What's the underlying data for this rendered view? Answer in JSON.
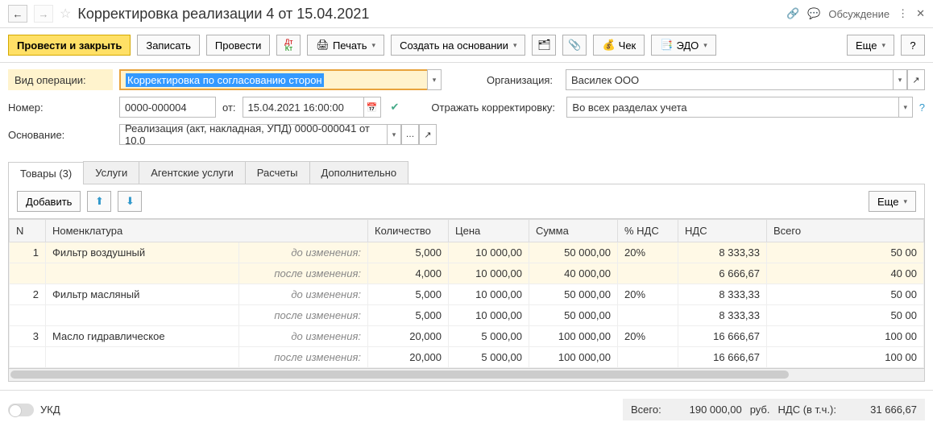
{
  "titlebar": {
    "title": "Корректировка реализации 4 от 15.04.2021",
    "discuss": "Обсуждение"
  },
  "toolbar": {
    "post_close": "Провести и закрыть",
    "save": "Записать",
    "post": "Провести",
    "print": "Печать",
    "create_based": "Создать на основании",
    "check": "Чек",
    "edo": "ЭДО",
    "more": "Еще",
    "help": "?"
  },
  "form": {
    "op_type_label": "Вид операции:",
    "op_type_value": "Корректировка по согласованию сторон",
    "number_label": "Номер:",
    "number_value": "0000-000004",
    "from_label": "от:",
    "date_value": "15.04.2021 16:00:00",
    "basis_label": "Основание:",
    "basis_value": "Реализация (акт, накладная, УПД) 0000-000041 от 10.0",
    "org_label": "Организация:",
    "org_value": "Василек ООО",
    "reflect_label": "Отражать корректировку:",
    "reflect_value": "Во всех разделах учета"
  },
  "tabs": {
    "goods": "Товары (3)",
    "services": "Услуги",
    "agent": "Агентские услуги",
    "calc": "Расчеты",
    "extra": "Дополнительно"
  },
  "tab_toolbar": {
    "add": "Добавить",
    "more": "Еще"
  },
  "table": {
    "headers": {
      "n": "N",
      "item": "Номенклатура",
      "qty": "Количество",
      "price": "Цена",
      "sum": "Сумма",
      "vat_pct": "% НДС",
      "vat": "НДС",
      "total": "Всего"
    },
    "before": "до изменения:",
    "after": "после изменения:",
    "rows": [
      {
        "n": "1",
        "name": "Фильтр воздушный",
        "before": {
          "qty": "5,000",
          "price": "10 000,00",
          "sum": "50 000,00",
          "vat_pct": "20%",
          "vat": "8 333,33",
          "total": "50 00"
        },
        "after": {
          "qty": "4,000",
          "price": "10 000,00",
          "sum": "40 000,00",
          "vat_pct": "",
          "vat": "6 666,67",
          "total": "40 00"
        }
      },
      {
        "n": "2",
        "name": "Фильтр масляный",
        "before": {
          "qty": "5,000",
          "price": "10 000,00",
          "sum": "50 000,00",
          "vat_pct": "20%",
          "vat": "8 333,33",
          "total": "50 00"
        },
        "after": {
          "qty": "5,000",
          "price": "10 000,00",
          "sum": "50 000,00",
          "vat_pct": "",
          "vat": "8 333,33",
          "total": "50 00"
        }
      },
      {
        "n": "3",
        "name": "Масло гидравлическое",
        "before": {
          "qty": "20,000",
          "price": "5 000,00",
          "sum": "100 000,00",
          "vat_pct": "20%",
          "vat": "16 666,67",
          "total": "100 00"
        },
        "after": {
          "qty": "20,000",
          "price": "5 000,00",
          "sum": "100 000,00",
          "vat_pct": "",
          "vat": "16 666,67",
          "total": "100 00"
        }
      }
    ]
  },
  "footer": {
    "ukd": "УКД",
    "total_label": "Всего:",
    "total_value": "190 000,00",
    "currency": "руб.",
    "vat_label": "НДС (в т.ч.):",
    "vat_value": "31 666,67"
  }
}
